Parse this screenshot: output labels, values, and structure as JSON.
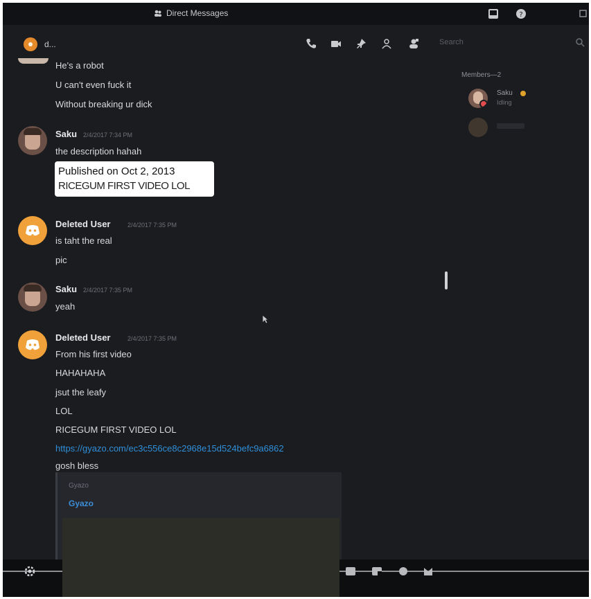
{
  "window": {
    "title": "Direct Messages"
  },
  "header": {
    "dm_name": "d...",
    "search_placeholder": "Search"
  },
  "members": {
    "heading": "Members—2",
    "items": [
      {
        "name": "Saku",
        "status": "Idling"
      }
    ]
  },
  "messages": {
    "top_lines": [
      "He's a robot",
      "U can't even fuck it",
      "Without breaking ur dick"
    ],
    "m1": {
      "author": "Saku",
      "time": "2/4/2017 7:34 PM",
      "lines": [
        "the description hahah"
      ]
    },
    "embedded_text": {
      "line1": "Published on Oct 2, 2013",
      "line2": "RICEGUM FIRST VIDEO LOL"
    },
    "m2": {
      "author": "Deleted User",
      "time": "2/4/2017 7:35 PM",
      "lines": [
        "is taht the real",
        "pic"
      ]
    },
    "m3": {
      "author": "Saku",
      "time": "2/4/2017 7:35 PM",
      "lines": [
        "yeah"
      ]
    },
    "m4": {
      "author": "Deleted User",
      "time": "2/4/2017 7:35 PM",
      "lines": [
        "From his first video",
        "HAHAHAHA",
        "jsut the leafy",
        "LOL",
        "RICEGUM FIRST VIDEO LOL"
      ],
      "link": "https://gyazo.com/ec3c556ce8c2968e15d524befc9a6862",
      "after_link": "gosh bless"
    },
    "embed": {
      "provider": "Gyazo",
      "title": "Gyazo"
    }
  },
  "colors": {
    "accent_link": "#2f8fd8",
    "discord_avatar": "#f0a13a",
    "background": "#1b1c20"
  }
}
